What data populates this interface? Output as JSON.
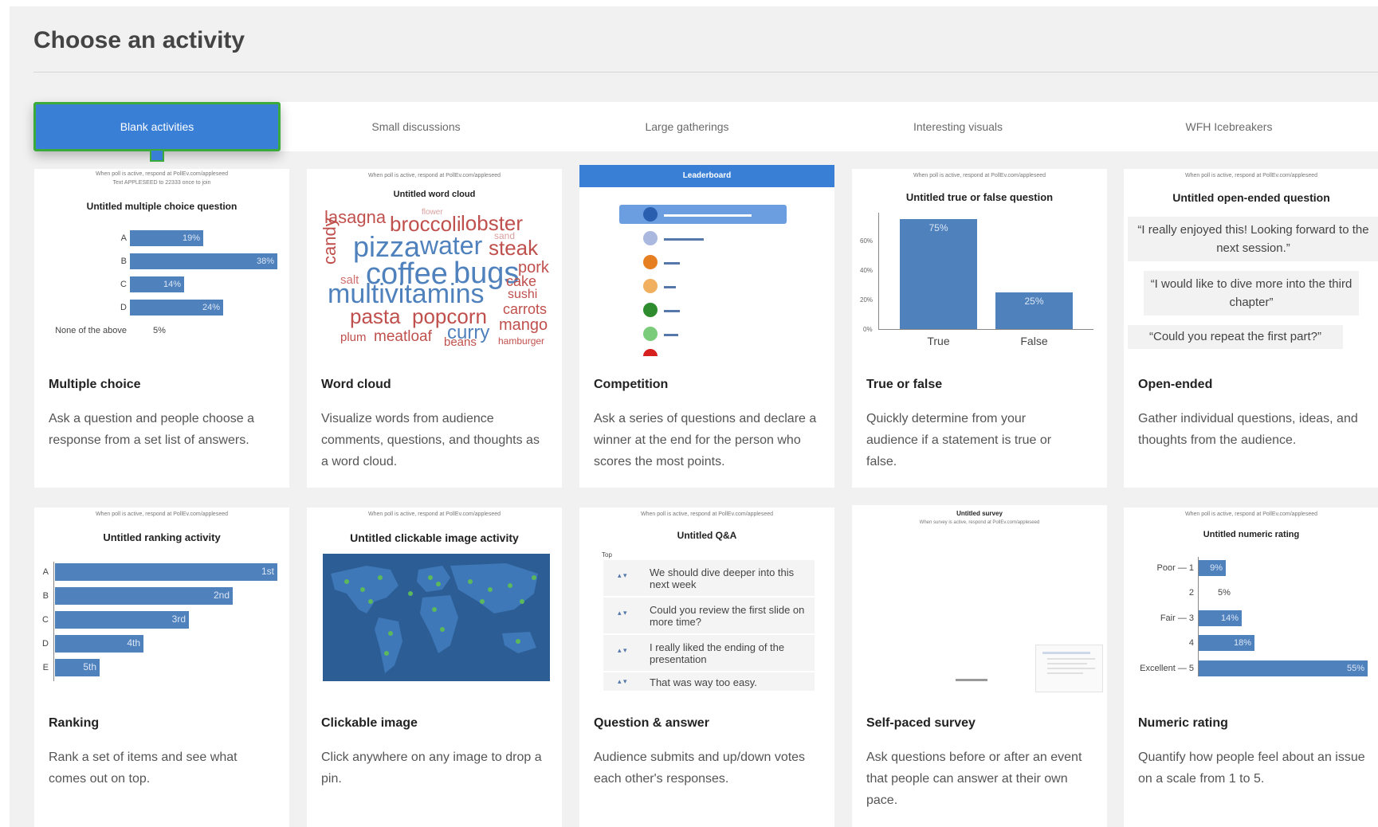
{
  "page_title": "Choose an activity",
  "tabs": [
    {
      "label": "Blank activities",
      "active": true
    },
    {
      "label": "Small discussions",
      "active": false
    },
    {
      "label": "Large gatherings",
      "active": false
    },
    {
      "label": "Interesting visuals",
      "active": false
    },
    {
      "label": "WFH Icebreakers",
      "active": false
    }
  ],
  "colors": {
    "accent": "#3a7fd6",
    "active_border": "#3aaa3a",
    "bar": "#4f81bd"
  },
  "respond_line": "When poll is active, respond at PollEv.com/appleseed",
  "respond_line_text": "Text APPLESEED to 22333 once to join",
  "cards": {
    "multiple_choice": {
      "preview_title": "Untitled multiple choice question",
      "options": [
        {
          "label": "A",
          "value": "19%"
        },
        {
          "label": "B",
          "value": "38%"
        },
        {
          "label": "C",
          "value": "14%"
        },
        {
          "label": "D",
          "value": "24%"
        },
        {
          "label": "None of the above",
          "value": "5%"
        }
      ],
      "title": "Multiple choice",
      "description": "Ask a question and people choose a response from a set list of answers."
    },
    "word_cloud": {
      "preview_title": "Untitled word cloud",
      "words": [
        "lasagna",
        "flower",
        "broccoli",
        "lobster",
        "candy",
        "pizza",
        "water",
        "sand",
        "steak",
        "coffee",
        "bugs",
        "pork",
        "salt",
        "multivitamins",
        "cake",
        "sushi",
        "pasta",
        "popcorn",
        "carrots",
        "curry",
        "mango",
        "plum",
        "meatloaf",
        "beans",
        "hamburger"
      ],
      "title": "Word cloud",
      "description": "Visualize words from audience comments, questions, and thoughts as a word cloud."
    },
    "competition": {
      "preview_title": "Leaderboard",
      "title": "Competition",
      "description": "Ask a series of questions and declare a winner at the end for the person who scores the most points."
    },
    "true_false": {
      "preview_title": "Untitled true or false question",
      "bars": [
        {
          "label": "True",
          "value": "75%"
        },
        {
          "label": "False",
          "value": "25%"
        }
      ],
      "ticks": [
        "60%",
        "40%",
        "20%",
        "0%"
      ],
      "title": "True or false",
      "description": "Quickly determine from your audience if a statement is true or false."
    },
    "open_ended": {
      "preview_title": "Untitled open-ended question",
      "responses": [
        "“I really enjoyed this! Looking forward to the next session.”",
        "“I would like to dive more into the third chapter”",
        "“Could you repeat the first part?”"
      ],
      "title": "Open-ended",
      "description": "Gather individual questions, ideas, and thoughts from the audience."
    },
    "ranking": {
      "preview_title": "Untitled ranking activity",
      "items": [
        {
          "label": "A",
          "rank": "1st"
        },
        {
          "label": "B",
          "rank": "2nd"
        },
        {
          "label": "C",
          "rank": "3rd"
        },
        {
          "label": "D",
          "rank": "4th"
        },
        {
          "label": "E",
          "rank": "5th"
        }
      ],
      "title": "Ranking",
      "description": "Rank a set of items and see what comes out on top."
    },
    "clickable_image": {
      "preview_title": "Untitled clickable image activity",
      "title": "Clickable image",
      "description": "Click anywhere on any image to drop a pin."
    },
    "qa": {
      "preview_title": "Untitled Q&A",
      "sort_label": "Top",
      "questions": [
        "We should dive deeper into this next week",
        "Could you review the first slide on more time?",
        "I really liked the ending of the presentation",
        "That was way too easy."
      ],
      "title": "Question & answer",
      "description": "Audience submits and up/down votes each other's responses."
    },
    "survey": {
      "preview_title": "Untitled survey",
      "preview_sub": "When survey is active, respond at PollEv.com/appleseed",
      "title": "Self-paced survey",
      "description": "Ask questions before or after an event that people can answer at their own pace."
    },
    "numeric": {
      "preview_title": "Untitled numeric rating",
      "rows": [
        {
          "label": "Poor — 1",
          "value": "9%"
        },
        {
          "label": "2",
          "value": "5%"
        },
        {
          "label": "Fair — 3",
          "value": "14%"
        },
        {
          "label": "4",
          "value": "18%"
        },
        {
          "label": "Excellent — 5",
          "value": "55%"
        }
      ],
      "title": "Numeric rating",
      "description": "Quantify how people feel about an issue on a scale from 1 to 5."
    }
  }
}
